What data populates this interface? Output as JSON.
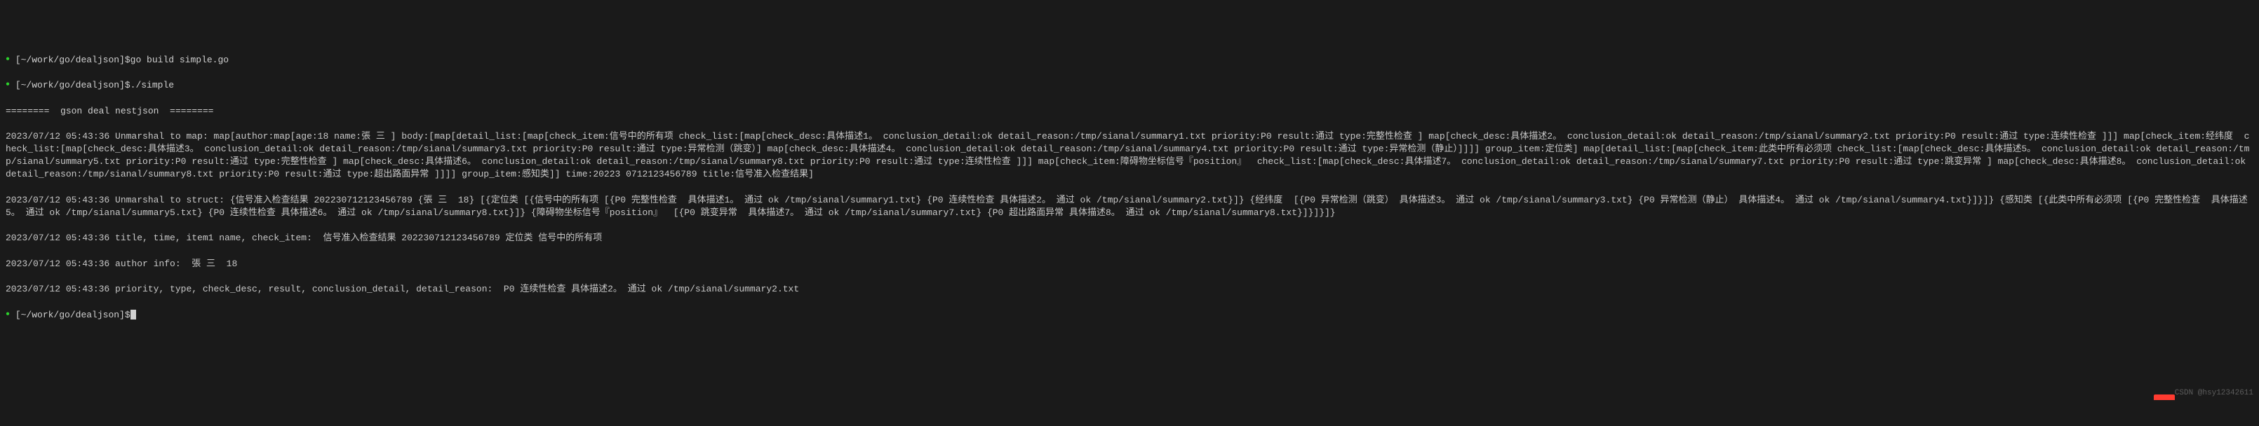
{
  "prompt1": {
    "dot": "●",
    "path": "[~/work/go/dealjson]$",
    "cmd": "go build simple.go"
  },
  "prompt2": {
    "dot": "●",
    "path": "[~/work/go/dealjson]$",
    "cmd": "./simple"
  },
  "sep_line": "========  gson deal nestjson  ========",
  "out1": "2023/07/12 05:43:36 Unmarshal to map: map[author:map[age:18 name:張 三 ] body:[map[detail_list:[map[check_item:信号中的所有项 check_list:[map[check_desc:具体描述1。 conclusion_detail:ok detail_reason:/tmp/sianal/summary1.txt priority:P0 result:通过 type:完整性检查 ] map[check_desc:具体描述2。 conclusion_detail:ok detail_reason:/tmp/sianal/summary2.txt priority:P0 result:通过 type:连续性检查 ]]] map[check_item:经纬度  check_list:[map[check_desc:具体描述3。 conclusion_detail:ok detail_reason:/tmp/sianal/summary3.txt priority:P0 result:通过 type:异常检测（跳变）] map[check_desc:具体描述4。 conclusion_detail:ok detail_reason:/tmp/sianal/summary4.txt priority:P0 result:通过 type:异常检测（静止）]]]] group_item:定位类] map[detail_list:[map[check_item:此类中所有必须项 check_list:[map[check_desc:具体描述5。 conclusion_detail:ok detail_reason:/tmp/sianal/summary5.txt priority:P0 result:通过 type:完整性检查 ] map[check_desc:具体描述6。 conclusion_detail:ok detail_reason:/tmp/sianal/summary8.txt priority:P0 result:通过 type:连续性检查 ]]] map[check_item:障碍物坐标信号『position』  check_list:[map[check_desc:具体描述7。 conclusion_detail:ok detail_reason:/tmp/sianal/summary7.txt priority:P0 result:通过 type:跳变异常 ] map[check_desc:具体描述8。 conclusion_detail:ok detail_reason:/tmp/sianal/summary8.txt priority:P0 result:通过 type:超出路面异常 ]]]] group_item:感知类]] time:20223 0712123456789 title:信号准入检查结果]",
  "out2": "2023/07/12 05:43:36 Unmarshal to struct: {信号准入检查结果 202230712123456789 {張 三  18} [{定位类 [{信号中的所有项 [{P0 完整性检查  具体描述1。 通过 ok /tmp/sianal/summary1.txt} {P0 连续性检查 具体描述2。 通过 ok /tmp/sianal/summary2.txt}]} {经纬度  [{P0 异常检测（跳变） 具体描述3。 通过 ok /tmp/sianal/summary3.txt} {P0 异常检测（静止） 具体描述4。 通过 ok /tmp/sianal/summary4.txt}]}]} {感知类 [{此类中所有必须项 [{P0 完整性检查  具体描述5。 通过 ok /tmp/sianal/summary5.txt} {P0 连续性检查 具体描述6。 通过 ok /tmp/sianal/summary8.txt}]} {障碍物坐标信号『position』  [{P0 跳变异常  具体描述7。 通过 ok /tmp/sianal/summary7.txt} {P0 超出路面异常 具体描述8。 通过 ok /tmp/sianal/summary8.txt}]}]}]}",
  "out3": "2023/07/12 05:43:36 title, time, item1 name, check_item:  信号准入检查结果 202230712123456789 定位类 信号中的所有项",
  "out4": "2023/07/12 05:43:36 author info:  張 三  18",
  "out5": "2023/07/12 05:43:36 priority, type, check_desc, result, conclusion_detail, detail_reason:  P0 连续性检查 具体描述2。 通过 ok /tmp/sianal/summary2.txt",
  "prompt3": {
    "dot": "●",
    "path": "[~/work/go/dealjson]$"
  },
  "watermark": "CSDN @hsy12342611"
}
